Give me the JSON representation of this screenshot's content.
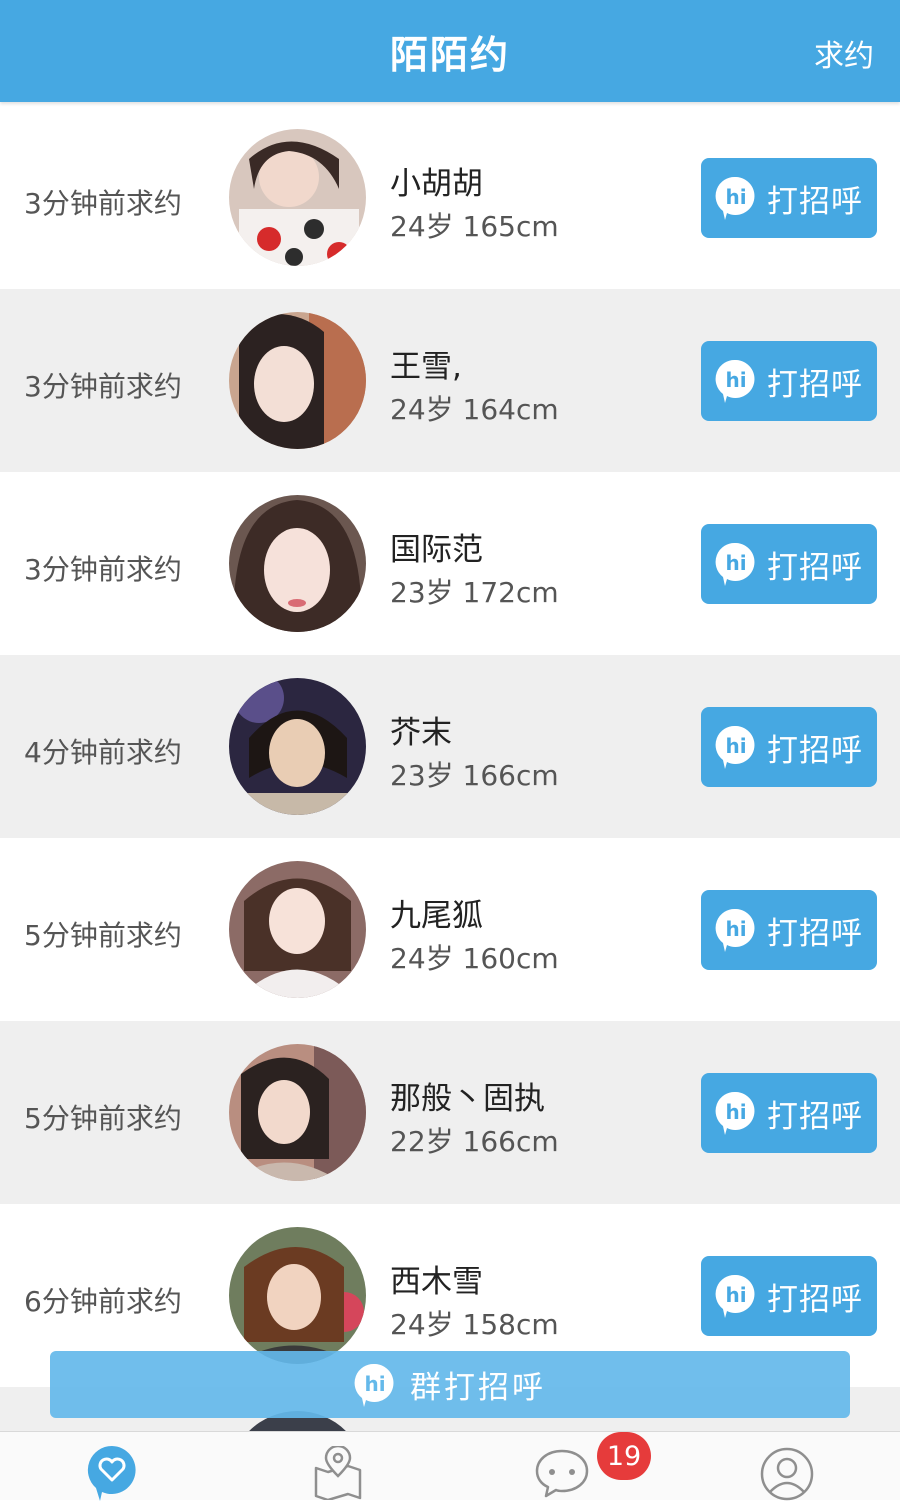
{
  "header": {
    "title": "陌陌约",
    "action": "求约"
  },
  "users": [
    {
      "time": "3分钟前求约",
      "name": "小胡胡",
      "info": "24岁 165cm",
      "greet": "打招呼"
    },
    {
      "time": "3分钟前求约",
      "name": "王雪,",
      "info": "24岁 164cm",
      "greet": "打招呼"
    },
    {
      "time": "3分钟前求约",
      "name": "国际范",
      "info": "23岁 172cm",
      "greet": "打招呼"
    },
    {
      "time": "4分钟前求约",
      "name": "芥末",
      "info": "23岁 166cm",
      "greet": "打招呼"
    },
    {
      "time": "5分钟前求约",
      "name": "九尾狐",
      "info": "24岁 160cm",
      "greet": "打招呼"
    },
    {
      "time": "5分钟前求约",
      "name": "那般丶固执",
      "info": "22岁 166cm",
      "greet": "打招呼"
    },
    {
      "time": "6分钟前求约",
      "name": "西木雪",
      "info": "24岁 158cm",
      "greet": "打招呼"
    }
  ],
  "group_greet": {
    "label": "群打招呼"
  },
  "tabbar": {
    "tabs": [
      {
        "icon": "heart-icon",
        "active": true
      },
      {
        "icon": "map-pin-icon",
        "active": false
      },
      {
        "icon": "chat-bubble-icon",
        "active": false
      },
      {
        "icon": "profile-icon",
        "active": false
      }
    ],
    "chat_badge": "19"
  },
  "colors": {
    "accent": "#46a8e2",
    "badge": "#e63b3b",
    "row_alt": "#efefef"
  }
}
